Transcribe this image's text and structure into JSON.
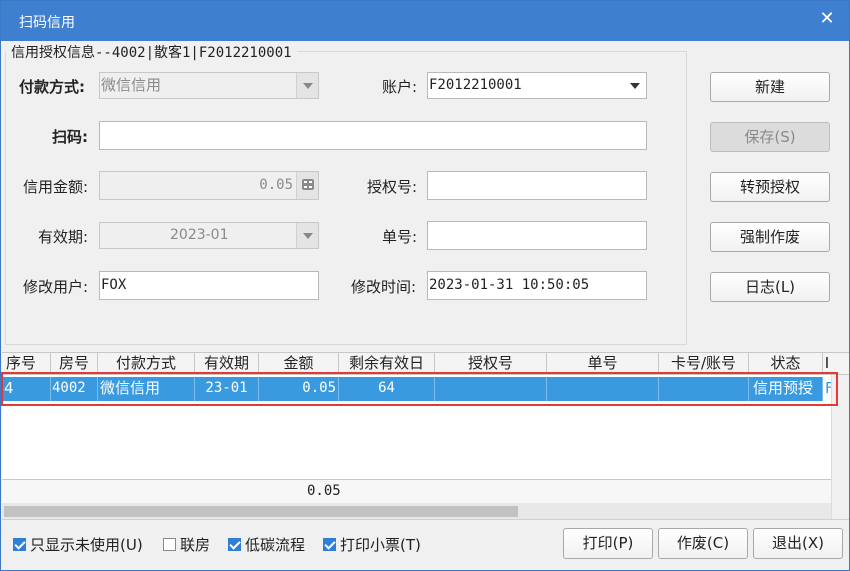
{
  "window": {
    "title": "扫码信用",
    "close_icon": "close-icon"
  },
  "group": {
    "label": "信用授权信息--4002|散客1|F2012210001"
  },
  "form": {
    "payment_method_label": "付款方式:",
    "payment_method_value": "微信信用",
    "account_label": "账户:",
    "account_value": "F2012210001",
    "scan_label": "扫码:",
    "scan_value": "",
    "amount_label": "信用金额:",
    "amount_value": "0.05",
    "auth_no_label": "授权号:",
    "auth_no_value": "",
    "validity_label": "有效期:",
    "validity_value": "2023-01",
    "order_no_label": "单号:",
    "order_no_value": "",
    "modifier_label": "修改用户:",
    "modifier_value": "FOX",
    "modified_time_label": "修改时间:",
    "modified_time_value": "2023-01-31 10:50:05"
  },
  "side_buttons": {
    "new": "新建",
    "save": "保存(S)",
    "convert": "转预授权",
    "void": "强制作废",
    "log": "日志(L)"
  },
  "grid": {
    "columns": [
      "序号",
      "房号",
      "付款方式",
      "有效期",
      "金额",
      "剩余有效日",
      "授权号",
      "单号",
      "卡号/账号",
      "状态",
      "I"
    ],
    "rows": [
      [
        "4",
        "4002",
        "微信信用",
        "23-01",
        "0.05",
        "64",
        "",
        "",
        "",
        "信用预授",
        "F"
      ]
    ],
    "sum_amount": "0.05"
  },
  "bottom": {
    "unused_only_label": "只显示未使用(U)",
    "unused_only_checked": true,
    "linked_room_label": "联房",
    "linked_room_checked": false,
    "low_carbon_label": "低碳流程",
    "low_carbon_checked": true,
    "print_receipt_label": "打印小票(T)",
    "print_receipt_checked": true,
    "print_button": "打印(P)",
    "void_button": "作废(C)",
    "exit_button": "退出(X)"
  },
  "colors": {
    "titlebar": "#3f7fd0",
    "selection": "#3a9ae0",
    "highlight_border": "#e53935"
  }
}
